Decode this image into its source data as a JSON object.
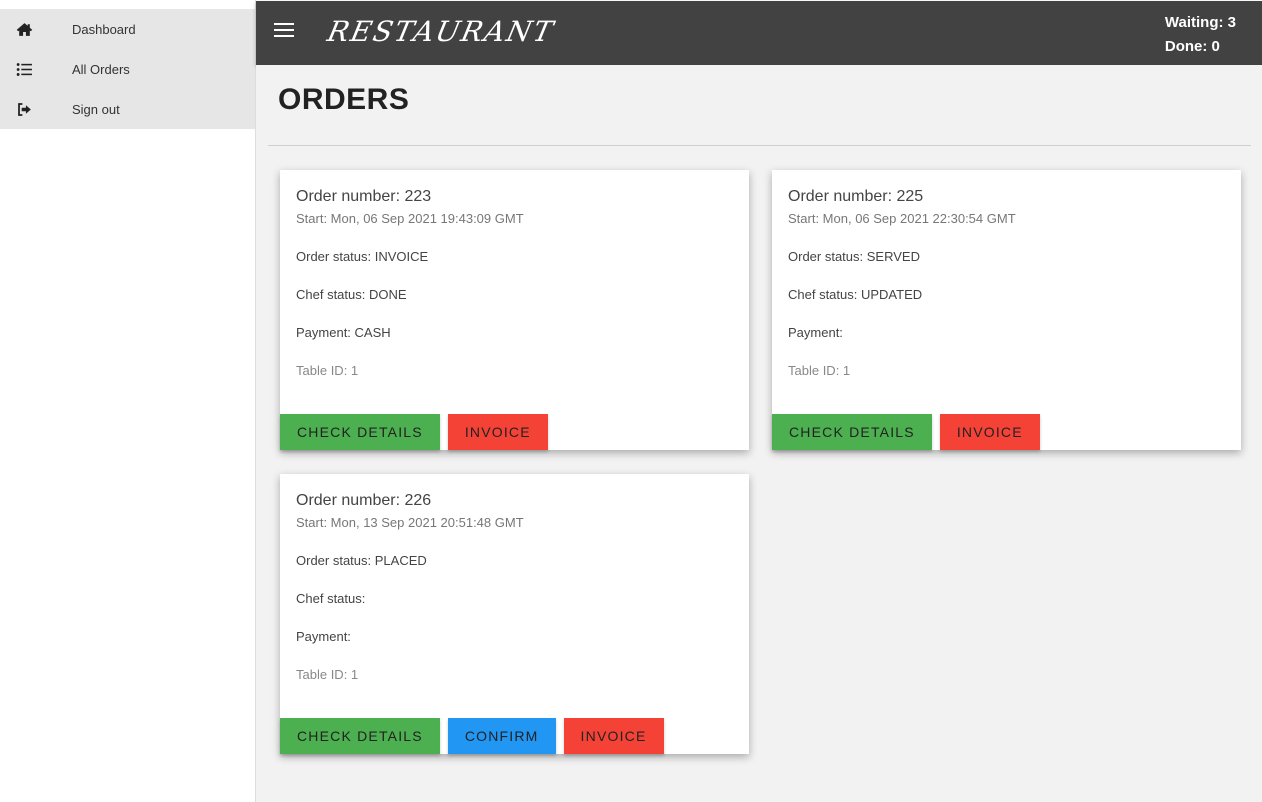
{
  "sidebar": {
    "items": [
      {
        "label": "Dashboard",
        "icon": "home-icon"
      },
      {
        "label": "All Orders",
        "icon": "list-icon"
      },
      {
        "label": "Sign out",
        "icon": "sign-out-icon"
      }
    ]
  },
  "header": {
    "brand": "RESTAURANT",
    "waiting": "Waiting: 3",
    "done": "Done: 0"
  },
  "main": {
    "title": "ORDERS",
    "orders": [
      {
        "number": "Order number: 223",
        "start": "Start: Mon, 06 Sep 2021 19:43:09 GMT",
        "order_status": "Order status: INVOICE",
        "chef_status": "Chef status: DONE",
        "payment": "Payment: CASH",
        "table": "Table ID: 1",
        "check_label": "CHECK DETAILS",
        "invoice_label": "INVOICE"
      },
      {
        "number": "Order number: 225",
        "start": "Start: Mon, 06 Sep 2021 22:30:54 GMT",
        "order_status": "Order status: SERVED",
        "chef_status": "Chef status: UPDATED",
        "payment": "Payment:",
        "table": "Table ID: 1",
        "check_label": "CHECK DETAILS",
        "invoice_label": "INVOICE"
      },
      {
        "number": "Order number: 226",
        "start": "Start: Mon, 13 Sep 2021 20:51:48 GMT",
        "order_status": "Order status: PLACED",
        "chef_status": "Chef status:",
        "payment": "Payment:",
        "table": "Table ID: 1",
        "check_label": "CHECK DETAILS",
        "confirm_label": "CONFIRM",
        "invoice_label": "INVOICE"
      }
    ]
  },
  "colors": {
    "header_bg": "#424242",
    "green": "#4caf50",
    "blue": "#2196f3",
    "red": "#f44336"
  }
}
